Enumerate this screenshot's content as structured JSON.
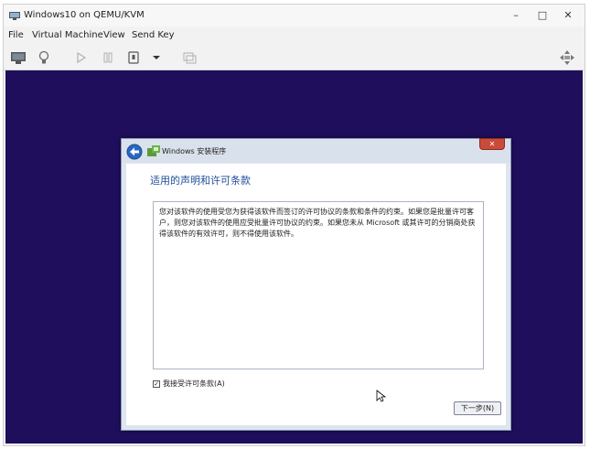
{
  "window": {
    "title": "Windows10 on QEMU/KVM",
    "controls": {
      "minimize": "–",
      "maximize": "□",
      "close": "✕"
    }
  },
  "menu": {
    "items": [
      "File",
      "Virtual Machine",
      "View",
      "Send Key"
    ]
  },
  "toolbar": {
    "icons": [
      "monitor-icon",
      "bulb-icon",
      "play-icon",
      "pause-icon",
      "power-icon",
      "dropdown-arrow-icon",
      "snapshot-icon",
      "resize-icon"
    ]
  },
  "guest": {
    "background_color": "#1f0e5b",
    "dialog": {
      "title": "Windows 安装程序",
      "close_label": "✕",
      "heading": "适用的声明和许可条款",
      "license_text": "您对该软件的使用受您为获得该软件而签订的许可协议的条款和条件的约束。如果您是批量许可客户，则您对该软件的使用应受批量许可协议的约束。如果您未从 Microsoft 或其许可的分销商处获得该软件的有效许可，则不得使用该软件。",
      "accept_label": "我接受许可条款(A)",
      "accept_checked": true,
      "next_label": "下一步(N)"
    }
  }
}
